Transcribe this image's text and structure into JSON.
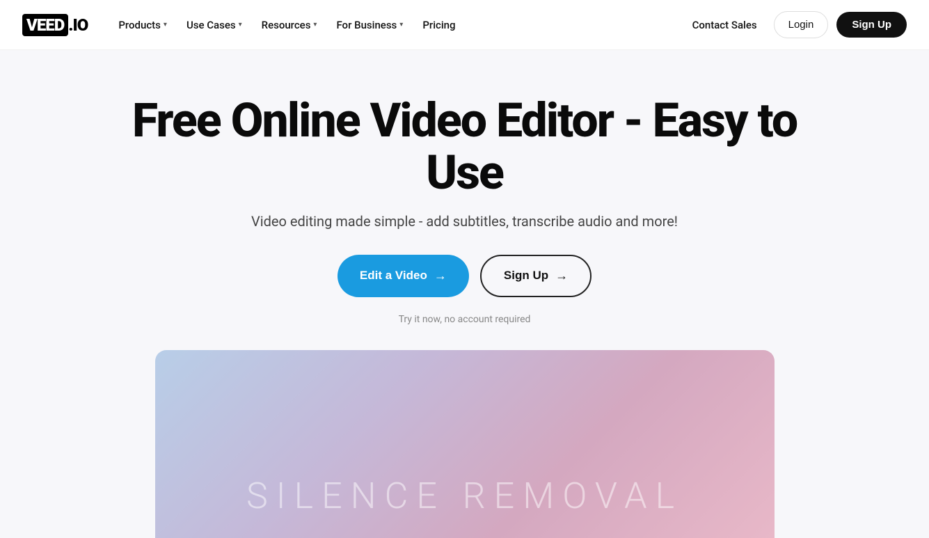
{
  "logo": {
    "text": "VEED.IO"
  },
  "nav": {
    "links": [
      {
        "label": "Products",
        "has_chevron": true
      },
      {
        "label": "Use Cases",
        "has_chevron": true
      },
      {
        "label": "Resources",
        "has_chevron": true
      },
      {
        "label": "For Business",
        "has_chevron": true
      },
      {
        "label": "Pricing",
        "has_chevron": false
      }
    ],
    "contact_sales": "Contact Sales",
    "login": "Login",
    "signup": "Sign Up"
  },
  "hero": {
    "title": "Free Online Video Editor - Easy to Use",
    "subtitle": "Video editing made simple - add subtitles, transcribe audio and more!",
    "btn_primary": "Edit a Video",
    "btn_secondary": "Sign Up",
    "note": "Try it now, no account required",
    "video_label": "Silence Removal"
  }
}
